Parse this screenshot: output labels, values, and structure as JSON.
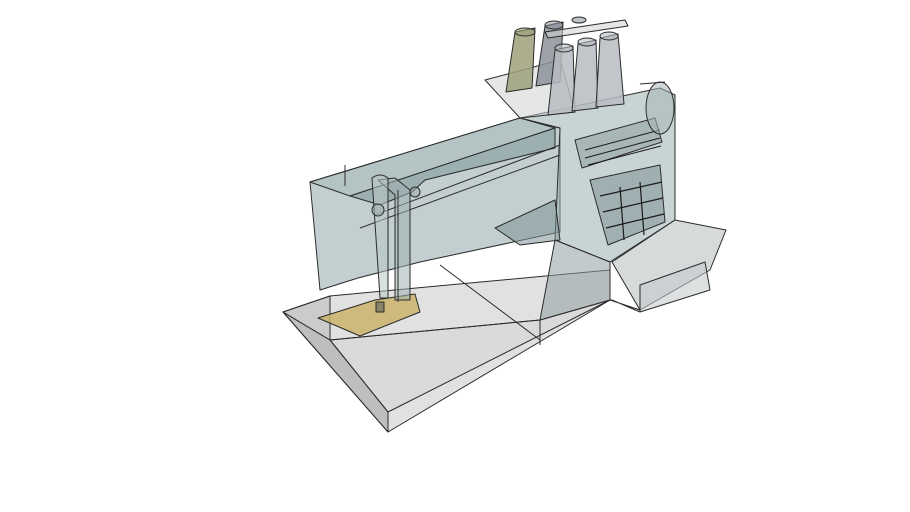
{
  "scene": {
    "subject": "sewing-machine-3d-model",
    "render_style": "x-ray wireframe"
  },
  "colors": {
    "background": "#ffffff",
    "outline": "#2b2b2b",
    "glass_body": "#8fa6a8",
    "base_top": "#c9c9c9",
    "base_side": "#a3a3a3",
    "needle_plate": "#c9b36a",
    "spool_olive": "#9da07a",
    "spool_grey": "#8c929a",
    "spool_light": "#b7bcc2"
  }
}
